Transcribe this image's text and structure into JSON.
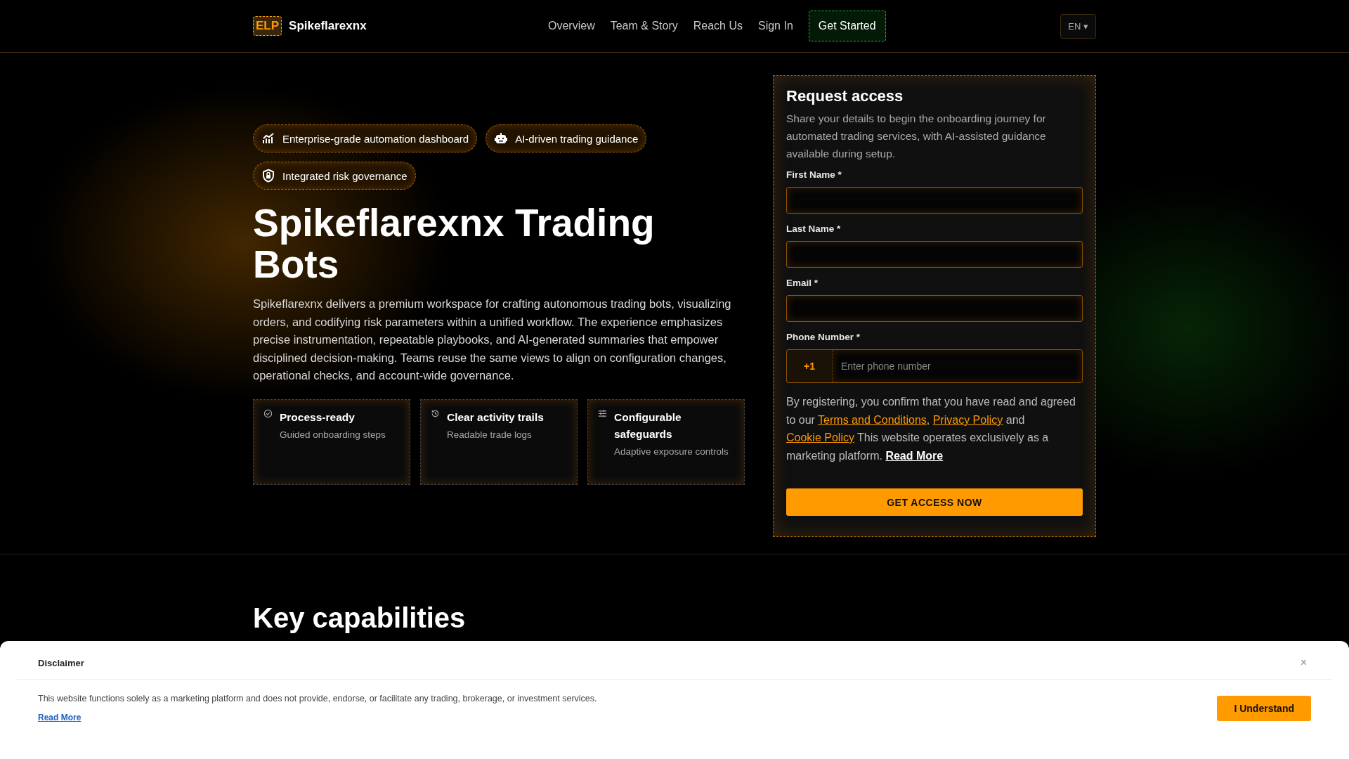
{
  "header": {
    "logo_badge": "ELP",
    "brand": "Spikeflarexnx",
    "nav": [
      "Overview",
      "Team & Story",
      "Reach Us",
      "Sign In"
    ],
    "cta": "Get Started",
    "language": "EN ▾"
  },
  "hero": {
    "badges": [
      {
        "kind": "chart",
        "label": "Enterprise-grade automation dashboard"
      },
      {
        "kind": "robot",
        "label": "AI-driven trading guidance"
      },
      {
        "kind": "shield",
        "label": "Integrated risk governance"
      }
    ],
    "title": "Spikeflarexnx Trading Bots",
    "description": "Spikeflarexnx delivers a premium workspace for crafting autonomous trading bots, visualizing orders, and codifying risk parameters within a unified workflow. The experience emphasizes precise instrumentation, repeatable playbooks, and AI-generated summaries that empower disciplined decision-making. Teams reuse the same views to align on configuration changes, operational checks, and account-wide governance.",
    "features": [
      {
        "kind": "check",
        "title": "Process-ready",
        "subtitle": "Guided onboarding steps"
      },
      {
        "kind": "history",
        "title": "Clear activity trails",
        "subtitle": "Readable trade logs"
      },
      {
        "kind": "sliders",
        "title": "Configurable safeguards",
        "subtitle": "Adaptive exposure controls"
      }
    ]
  },
  "form": {
    "title": "Request access",
    "intro": "Share your details to begin the onboarding journey for automated trading services, with AI-assisted guidance available during setup.",
    "fields": [
      {
        "kind": "text",
        "label": "First Name *"
      },
      {
        "kind": "text",
        "label": "Last Name *"
      },
      {
        "kind": "text",
        "label": "Email *"
      },
      {
        "kind": "phone",
        "label": "Phone Number *",
        "prefix": "+1",
        "placeholder": "Enter phone number"
      }
    ],
    "consent": [
      {
        "kind": "text",
        "text": "By registering, you confirm that you have read and agreed to our "
      },
      {
        "kind": "link",
        "text": "Terms and Conditions"
      },
      {
        "kind": "text",
        "text": ", "
      },
      {
        "kind": "link",
        "text": "Privacy Policy"
      },
      {
        "kind": "text",
        "text": " and "
      },
      {
        "kind": "link",
        "text": "Cookie Policy"
      },
      {
        "kind": "text",
        "text": " This website operates exclusively as a marketing platform. "
      },
      {
        "kind": "strong_link",
        "text": "Read More"
      }
    ],
    "submit": "GET ACCESS NOW"
  },
  "capabilities": {
    "title": "Key capabilities"
  },
  "disclaimer": {
    "title": "Disclaimer",
    "close": "×",
    "text": "This website functions solely as a marketing platform and does not provide, endorse, or facilitate any trading, brokerage, or investment services.",
    "link": "Read More",
    "button": "I Understand"
  }
}
